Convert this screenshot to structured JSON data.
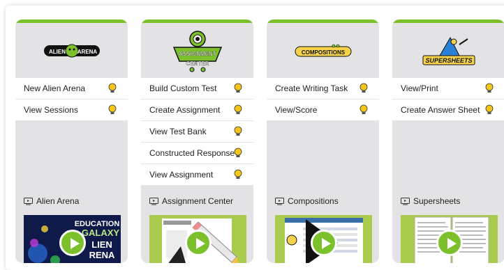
{
  "colors": {
    "accent": "#7cc12b",
    "card_bg": "#e3e3e6",
    "bulb": "#f5c518"
  },
  "cards": [
    {
      "logo_text": [
        "ALIEN",
        "ARENA"
      ],
      "items": [
        {
          "label": "New Alien Arena",
          "icon": "lightbulb-icon"
        },
        {
          "label": "View Sessions",
          "icon": "lightbulb-icon"
        }
      ],
      "footer_title": "Alien Arena",
      "video_text": [
        "EDUCATION",
        "GALAXY",
        "LIEN",
        "RENA"
      ]
    },
    {
      "logo_text": [
        "ASSIGNMENT",
        "CENTER"
      ],
      "items": [
        {
          "label": "Build Custom Test",
          "icon": "lightbulb-icon"
        },
        {
          "label": "Create Assignment",
          "icon": "lightbulb-icon"
        },
        {
          "label": "View Test Bank",
          "icon": "lightbulb-icon"
        },
        {
          "label": "Constructed Response",
          "icon": "lightbulb-icon"
        },
        {
          "label": "View Assignment",
          "icon": "lightbulb-icon"
        }
      ],
      "footer_title": "Assignment Center"
    },
    {
      "logo_text": "COMPOSITIONS",
      "items": [
        {
          "label": "Create Writing Task",
          "icon": "lightbulb-icon"
        },
        {
          "label": "View/Score",
          "icon": "lightbulb-icon"
        }
      ],
      "footer_title": "Compositions"
    },
    {
      "logo_text": "SUPERSHEETS",
      "items": [
        {
          "label": "View/Print",
          "icon": "lightbulb-icon"
        },
        {
          "label": "Create Answer Sheet",
          "icon": "lightbulb-icon"
        }
      ],
      "footer_title": "Supersheets"
    }
  ]
}
